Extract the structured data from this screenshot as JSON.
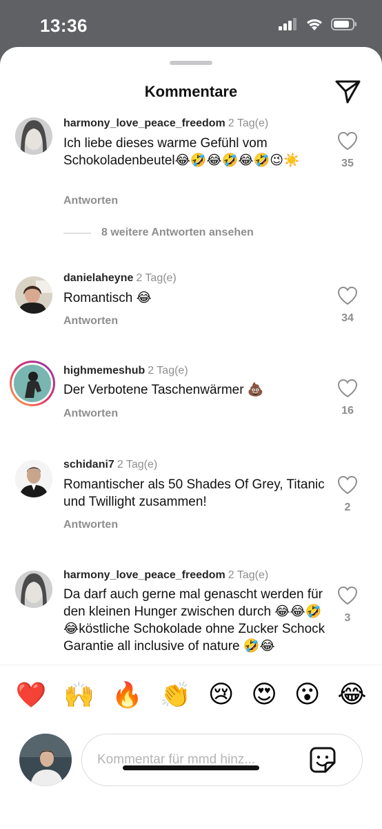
{
  "status": {
    "time": "13:36"
  },
  "header": {
    "title": "Kommentare"
  },
  "comments": [
    {
      "user": "harmony_love_peace_freedom",
      "time": "2 Tag(e)",
      "text": "Ich liebe dieses warme Gefühl vom Schokoladenbeutel😂🤣😂🤣😂🤣😉☀️",
      "reply": "Antworten",
      "likes": "35",
      "more_replies": "8 weitere Antworten ansehen"
    },
    {
      "user": "danielaheyne",
      "time": "2 Tag(e)",
      "text": "Romantisch 😂",
      "reply": "Antworten",
      "likes": "34"
    },
    {
      "user": "highmemeshub",
      "time": "2 Tag(e)",
      "text": "Der Verbotene Taschenwärmer 💩",
      "reply": "Antworten",
      "likes": "16"
    },
    {
      "user": "schidani7",
      "time": "2 Tag(e)",
      "text": "Romantischer als 50 Shades Of Grey, Titanic und Twillight zusammen!",
      "reply": "Antworten",
      "likes": "2"
    },
    {
      "user": "harmony_love_peace_freedom",
      "time": "2 Tag(e)",
      "text": "Da darf auch gerne mal genascht werden für den kleinen Hunger zwischen durch 😂😂🤣😂köstliche Schokolade ohne Zucker Schock Garantie all inclusive of nature 🤣😂",
      "likes": "3"
    }
  ],
  "emojis": [
    "❤️",
    "🙌",
    "🔥",
    "👏",
    "😢",
    "😍",
    "😮",
    "😂"
  ],
  "input": {
    "placeholder": "Kommentar für mmd hinz..."
  }
}
